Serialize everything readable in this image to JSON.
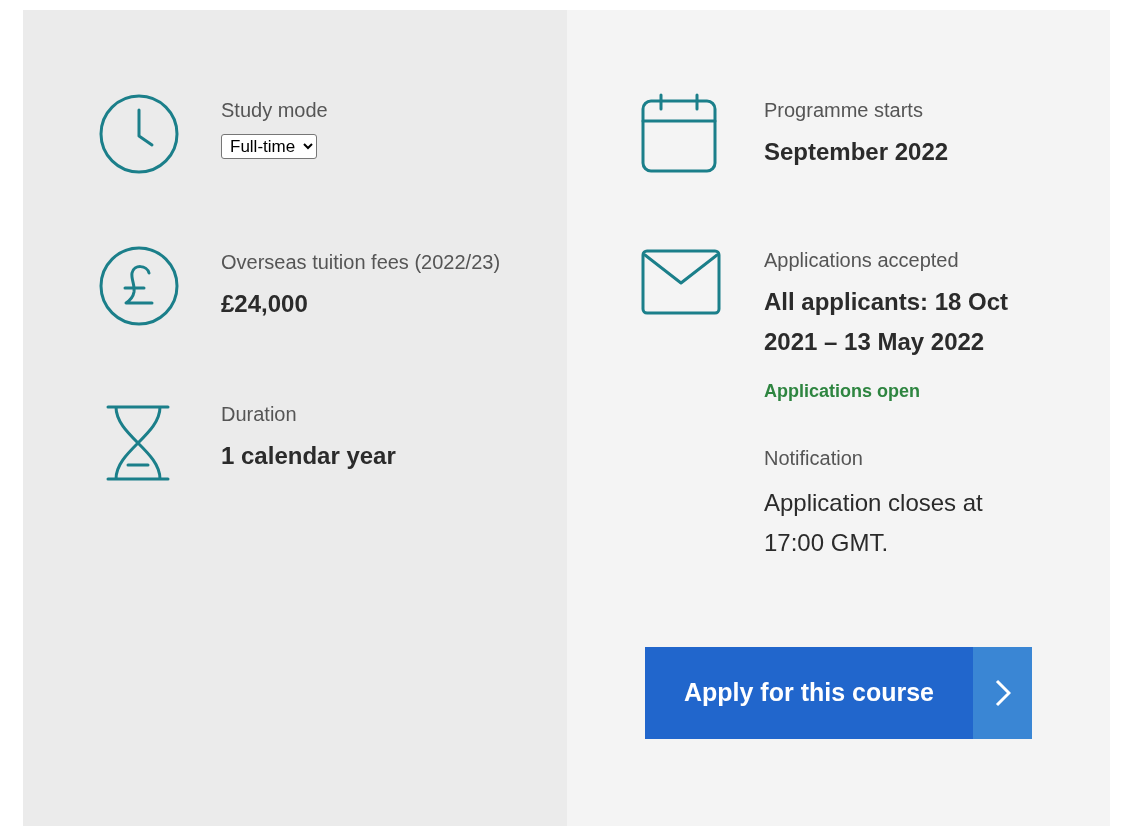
{
  "left": [
    {
      "kind": "select",
      "label": "Study mode",
      "value": "Full-time"
    },
    {
      "kind": "value",
      "label": "Overseas tuition fees (2022/23)",
      "value": "£24,000"
    },
    {
      "kind": "value",
      "label": "Duration",
      "value": "1 calendar year"
    }
  ],
  "right": [
    {
      "kind": "value",
      "label": "Programme starts",
      "value": "September 2022"
    },
    {
      "kind": "value",
      "label": "Applications accepted",
      "value": "All applicants: 18 Oct 2021 – 13 May 2022",
      "status": "Applications open",
      "note_label": "Notification",
      "note": "Application closes at 17:00 GMT."
    }
  ],
  "apply_button": {
    "label": "Apply for this course"
  }
}
